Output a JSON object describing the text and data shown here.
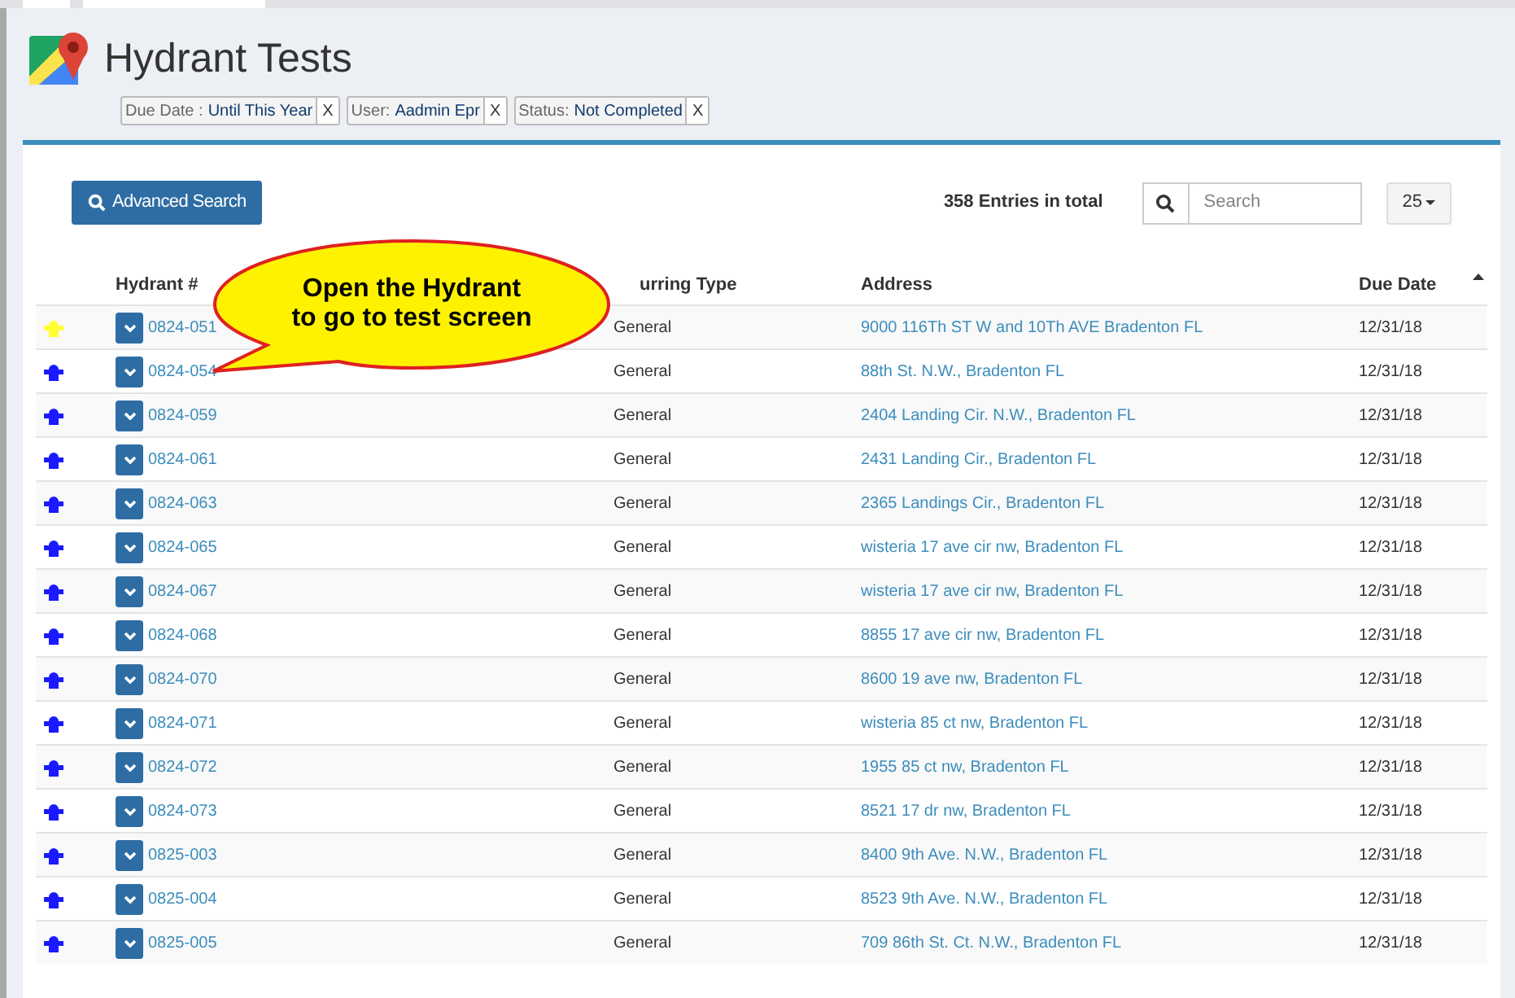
{
  "page": {
    "title": "Hydrant Tests"
  },
  "filters": [
    {
      "label": "Due Date :",
      "value": "Until This Year",
      "remove": "X"
    },
    {
      "label": "User:",
      "value": "Aadmin Epr",
      "remove": "X"
    },
    {
      "label": "Status:",
      "value": "Not Completed",
      "remove": "X"
    }
  ],
  "toolbar": {
    "advanced_search": "Advanced Search",
    "total": "358 Entries in total",
    "search": {
      "placeholder": "Search"
    },
    "page_size": "25"
  },
  "callout": {
    "lines": [
      "Open the Hydrant",
      "to go to test screen"
    ]
  },
  "table": {
    "columns": [
      "Hydrant #",
      "urring Type",
      "Address",
      "Due Date"
    ],
    "rows": [
      {
        "color": "#ffff33",
        "hydrant": "0824-051",
        "type": "General",
        "address": "9000 116Th ST W and 10Th AVE Bradenton FL",
        "due": "12/31/18"
      },
      {
        "color": "#1a1aff",
        "hydrant": "0824-054",
        "type": "General",
        "address": "88th St. N.W., Bradenton FL",
        "due": "12/31/18"
      },
      {
        "color": "#1a1aff",
        "hydrant": "0824-059",
        "type": "General",
        "address": "2404 Landing Cir. N.W., Bradenton FL",
        "due": "12/31/18"
      },
      {
        "color": "#1a1aff",
        "hydrant": "0824-061",
        "type": "General",
        "address": "2431 Landing Cir., Bradenton FL",
        "due": "12/31/18"
      },
      {
        "color": "#1a1aff",
        "hydrant": "0824-063",
        "type": "General",
        "address": "2365 Landings Cir., Bradenton FL",
        "due": "12/31/18"
      },
      {
        "color": "#1a1aff",
        "hydrant": "0824-065",
        "type": "General",
        "address": "wisteria 17 ave cir nw, Bradenton FL",
        "due": "12/31/18"
      },
      {
        "color": "#1a1aff",
        "hydrant": "0824-067",
        "type": "General",
        "address": "wisteria 17 ave cir nw, Bradenton FL",
        "due": "12/31/18"
      },
      {
        "color": "#1a1aff",
        "hydrant": "0824-068",
        "type": "General",
        "address": "8855 17 ave cir nw, Bradenton FL",
        "due": "12/31/18"
      },
      {
        "color": "#1a1aff",
        "hydrant": "0824-070",
        "type": "General",
        "address": "8600 19 ave nw, Bradenton FL",
        "due": "12/31/18"
      },
      {
        "color": "#1a1aff",
        "hydrant": "0824-071",
        "type": "General",
        "address": "wisteria 85 ct nw, Bradenton FL",
        "due": "12/31/18"
      },
      {
        "color": "#1a1aff",
        "hydrant": "0824-072",
        "type": "General",
        "address": "1955 85 ct nw, Bradenton FL",
        "due": "12/31/18"
      },
      {
        "color": "#1a1aff",
        "hydrant": "0824-073",
        "type": "General",
        "address": "8521 17 dr nw, Bradenton FL",
        "due": "12/31/18"
      },
      {
        "color": "#1a1aff",
        "hydrant": "0825-003",
        "type": "General",
        "address": "8400 9th Ave. N.W., Bradenton FL",
        "due": "12/31/18"
      },
      {
        "color": "#1a1aff",
        "hydrant": "0825-004",
        "type": "General",
        "address": "8523 9th Ave. N.W., Bradenton FL",
        "due": "12/31/18"
      },
      {
        "color": "#1a1aff",
        "hydrant": "0825-005",
        "type": "General",
        "address": "709 86th St. Ct. N.W., Bradenton FL",
        "due": "12/31/18"
      }
    ]
  }
}
